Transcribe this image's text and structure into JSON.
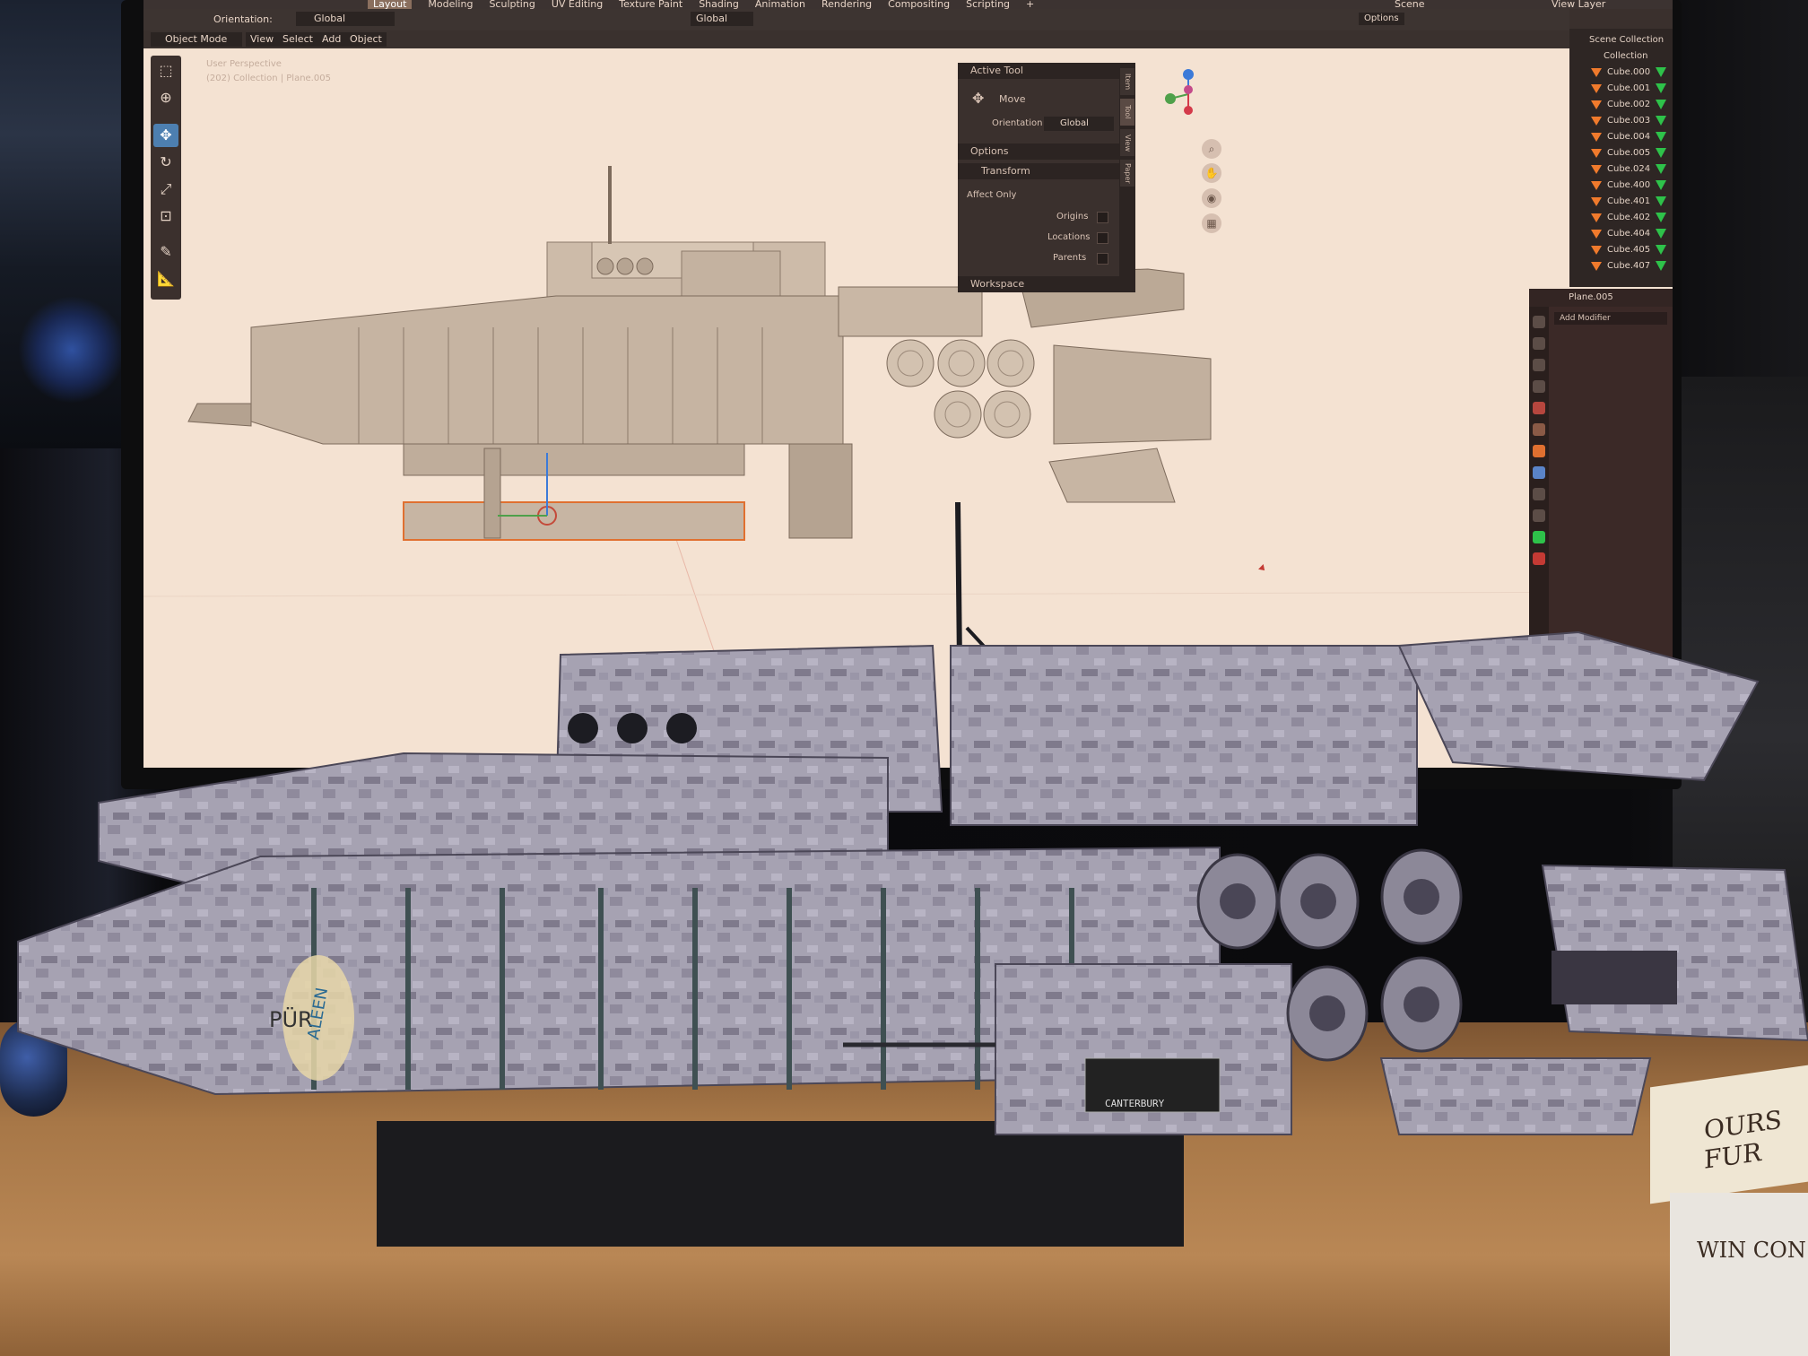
{
  "top_bar": {
    "workspace_tabs": [
      "Layout",
      "Modeling",
      "Sculpting",
      "UV Editing",
      "Texture Paint",
      "Shading",
      "Animation",
      "Rendering",
      "Compositing",
      "Scripting"
    ],
    "active_tab": "Layout",
    "add_tab": "+",
    "scene": "Scene",
    "view_layer": "View Layer"
  },
  "header": {
    "orientation_label": "Orientation:",
    "orientation_value": "Global",
    "pivot_value": "Global",
    "options_label": "Options"
  },
  "viewport_header": {
    "mode": "Object Mode",
    "menus": [
      "View",
      "Select",
      "Add",
      "Object"
    ]
  },
  "viewport": {
    "perspective_label": "User Perspective",
    "context_label": "(202) Collection | Plane.005"
  },
  "n_panel": {
    "active_tool_header": "Active Tool",
    "tool_name": "Move",
    "orientation_label": "Orientation",
    "orientation_value": "Global",
    "options_header": "Options",
    "transform_header": "Transform",
    "affect_only_label": "Affect Only",
    "checkboxes": [
      "Origins",
      "Locations",
      "Parents"
    ],
    "workspace_header": "Workspace",
    "tabs": [
      "Item",
      "Tool",
      "View",
      "Paper"
    ]
  },
  "outliner": {
    "scene_collection": "Scene Collection",
    "collection": "Collection",
    "items": [
      "Cube.000",
      "Cube.001",
      "Cube.002",
      "Cube.003",
      "Cube.004",
      "Cube.005",
      "Cube.024",
      "Cube.400",
      "Cube.401",
      "Cube.402",
      "Cube.404",
      "Cube.405",
      "Cube.407"
    ]
  },
  "properties": {
    "object_name": "Plane.005",
    "add_modifier": "Add Modifier"
  },
  "colors": {
    "viewport_bg": "#f4e2d2",
    "model_grey": "#c9b8a8",
    "ui_dark": "#3a302d",
    "accent_blue": "#4d7fb0",
    "object_orange": "#f07a2c",
    "modifier_green": "#2ec24a"
  },
  "physical_model": {
    "decal_left": "PÜR",
    "decal_right": "ALEEN",
    "nameplate": "CANTERBURY"
  },
  "books": {
    "top": "OURS FUR",
    "bottom": "WIN CON"
  }
}
